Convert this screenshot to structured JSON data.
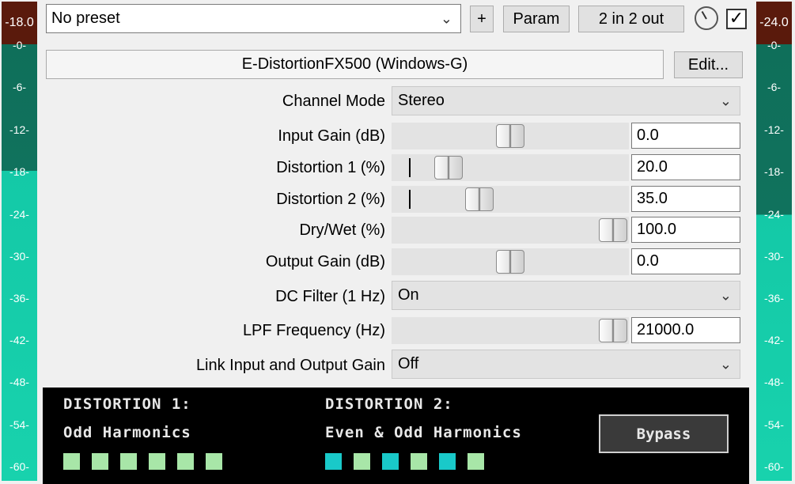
{
  "meters": {
    "left_peak": "-18.0",
    "right_peak": "-24.0",
    "scale": [
      "-0-",
      "-6-",
      "-12-",
      "-18-",
      "-24-",
      "-30-",
      "-36-",
      "-42-",
      "-48-",
      "-54-",
      "-60-"
    ]
  },
  "toolbar": {
    "preset": "No preset",
    "add_label": "+",
    "param_label": "Param",
    "io_label": "2 in 2 out",
    "enabled_check": "✓"
  },
  "plugin": {
    "title": "E-DistortionFX500 (Windows-G)",
    "edit_label": "Edit..."
  },
  "params": {
    "channel_mode": {
      "label": "Channel Mode",
      "value": "Stereo"
    },
    "input_gain": {
      "label": "Input Gain (dB)",
      "value": "0.0",
      "position": 0.5
    },
    "distortion1": {
      "label": "Distortion 1 (%)",
      "value": "20.0",
      "position": 0.2
    },
    "distortion2": {
      "label": "Distortion 2 (%)",
      "value": "35.0",
      "position": 0.35
    },
    "dry_wet": {
      "label": "Dry/Wet (%)",
      "value": "100.0",
      "position": 1.0
    },
    "output_gain": {
      "label": "Output Gain (dB)",
      "value": "0.0",
      "position": 0.5
    },
    "dc_filter": {
      "label": "DC Filter (1 Hz)",
      "value": "On"
    },
    "lpf_freq": {
      "label": "LPF Frequency (Hz)",
      "value": "21000.0",
      "position": 1.0
    },
    "link_gain": {
      "label": "Link Input and Output Gain",
      "value": "Off"
    }
  },
  "panel": {
    "d1_title": "DISTORTION 1:",
    "d1_desc": "Odd Harmonics",
    "d2_title": "DISTORTION 2:",
    "d2_desc": "Even & Odd Harmonics",
    "bypass_label": "Bypass",
    "d1_squares": [
      "#a8e6a8",
      "#a8e6a8",
      "#a8e6a8",
      "#a8e6a8",
      "#a8e6a8",
      "#a8e6a8"
    ],
    "d2_squares": [
      "#19c9c9",
      "#a8e6a8",
      "#19c9c9",
      "#a8e6a8",
      "#19c9c9",
      "#a8e6a8"
    ]
  }
}
